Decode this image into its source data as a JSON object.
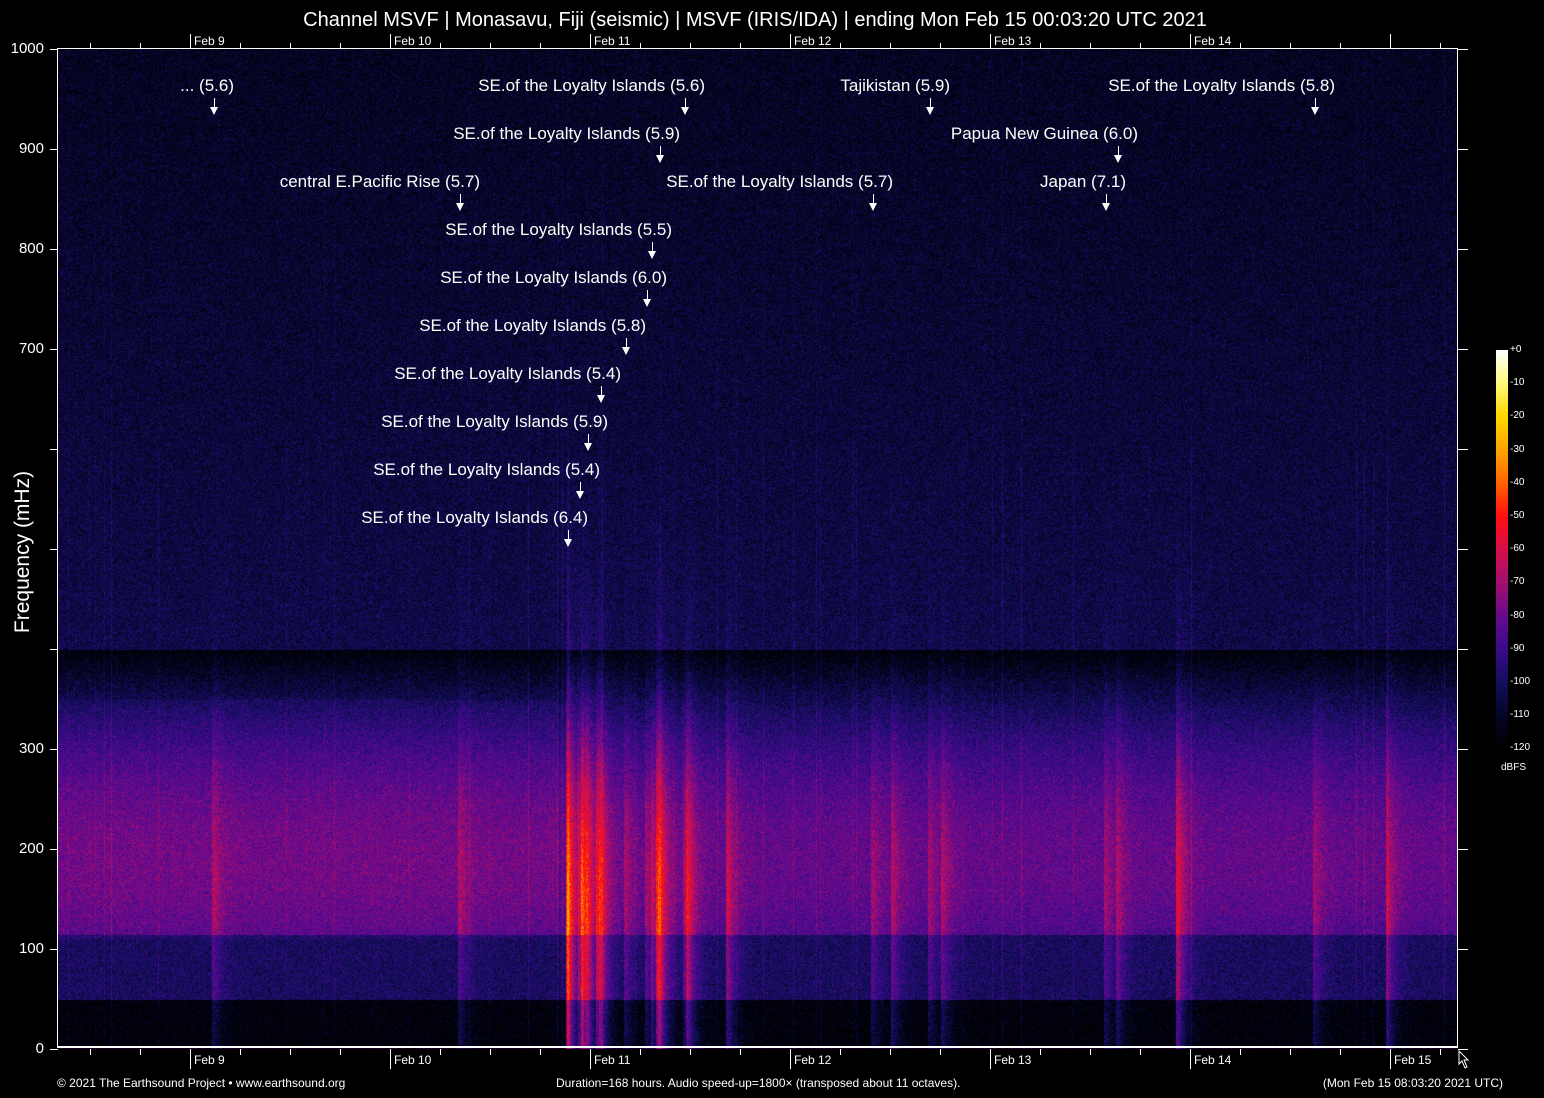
{
  "chart_data": {
    "type": "heatmap",
    "title": "Channel MSVF | Monasavu, Fiji (seismic) | MSVF (IRIS/IDA) | ending Mon Feb 15 00:03:20 UTC 2021",
    "ylabel": "Frequency (mHz)",
    "ylim": [
      0,
      1000
    ],
    "yticks": [
      0,
      100,
      200,
      300,
      400,
      500,
      600,
      700,
      800,
      900,
      1000
    ],
    "ytick_labels": [
      "0",
      "100",
      "200",
      "300",
      "",
      "",
      "",
      "700",
      "800",
      "900",
      "1000"
    ],
    "xlim_feb_day": [
      8.34,
      15.34
    ],
    "xticks_top": [
      {
        "day": 9,
        "label": "Feb  9"
      },
      {
        "day": 10,
        "label": "Feb 10"
      },
      {
        "day": 11,
        "label": "Feb 11"
      },
      {
        "day": 12,
        "label": "Feb 12"
      },
      {
        "day": 13,
        "label": "Feb 13"
      },
      {
        "day": 14,
        "label": "Feb 14"
      }
    ],
    "xticks_bottom": [
      {
        "day": 9,
        "label": "Feb  9"
      },
      {
        "day": 10,
        "label": "Feb 10"
      },
      {
        "day": 11,
        "label": "Feb 11"
      },
      {
        "day": 12,
        "label": "Feb 12"
      },
      {
        "day": 13,
        "label": "Feb 13"
      },
      {
        "day": 14,
        "label": "Feb 14"
      },
      {
        "day": 15,
        "label": "Feb 15"
      }
    ],
    "events": [
      {
        "label": "... (5.6)",
        "day": 9.12
      },
      {
        "label": "SE.of the Loyalty Islands (5.6)",
        "day": 11.475
      },
      {
        "label": "Tajikistan (5.9)",
        "day": 12.7
      },
      {
        "label": "SE.of the Loyalty Islands (5.8)",
        "day": 14.625
      },
      {
        "label": "SE.of the Loyalty Islands (5.9)",
        "day": 11.35
      },
      {
        "label": "Papua New Guinea (6.0)",
        "day": 13.64
      },
      {
        "label": "central E.Pacific Rise (5.7)",
        "day": 10.35
      },
      {
        "label": "SE.of the Loyalty Islands (5.7)",
        "day": 12.415
      },
      {
        "label": "Japan (7.1)",
        "day": 13.58
      },
      {
        "label": "SE.of the Loyalty Islands (5.5)",
        "day": 11.31
      },
      {
        "label": "SE.of the Loyalty Islands (6.0)",
        "day": 11.285
      },
      {
        "label": "SE.of the Loyalty Islands (5.8)",
        "day": 11.18
      },
      {
        "label": "SE.of the Loyalty Islands (5.4)",
        "day": 11.055
      },
      {
        "label": "SE.of the Loyalty Islands (5.9)",
        "day": 10.99
      },
      {
        "label": "SE.of the Loyalty Islands (5.4)",
        "day": 10.95
      },
      {
        "label": "SE.of the Loyalty Islands (6.4)",
        "day": 10.89
      }
    ],
    "colorbar": {
      "unit": "dBFS",
      "range": [
        -120,
        0
      ],
      "tick_labels": [
        "+0",
        "-10",
        "-20",
        "-30",
        "-40",
        "-50",
        "-60",
        "-70",
        "-80",
        "-90",
        "-100",
        "-110",
        "-120"
      ]
    }
  },
  "footer": {
    "left": "© 2021 The Earthsound Project • www.earthsound.org",
    "center": "Duration=168 hours. Audio speed-up=1800× (transposed about 11 octaves).",
    "right": "(Mon Feb 15 08:03:20 2021 UTC)"
  }
}
